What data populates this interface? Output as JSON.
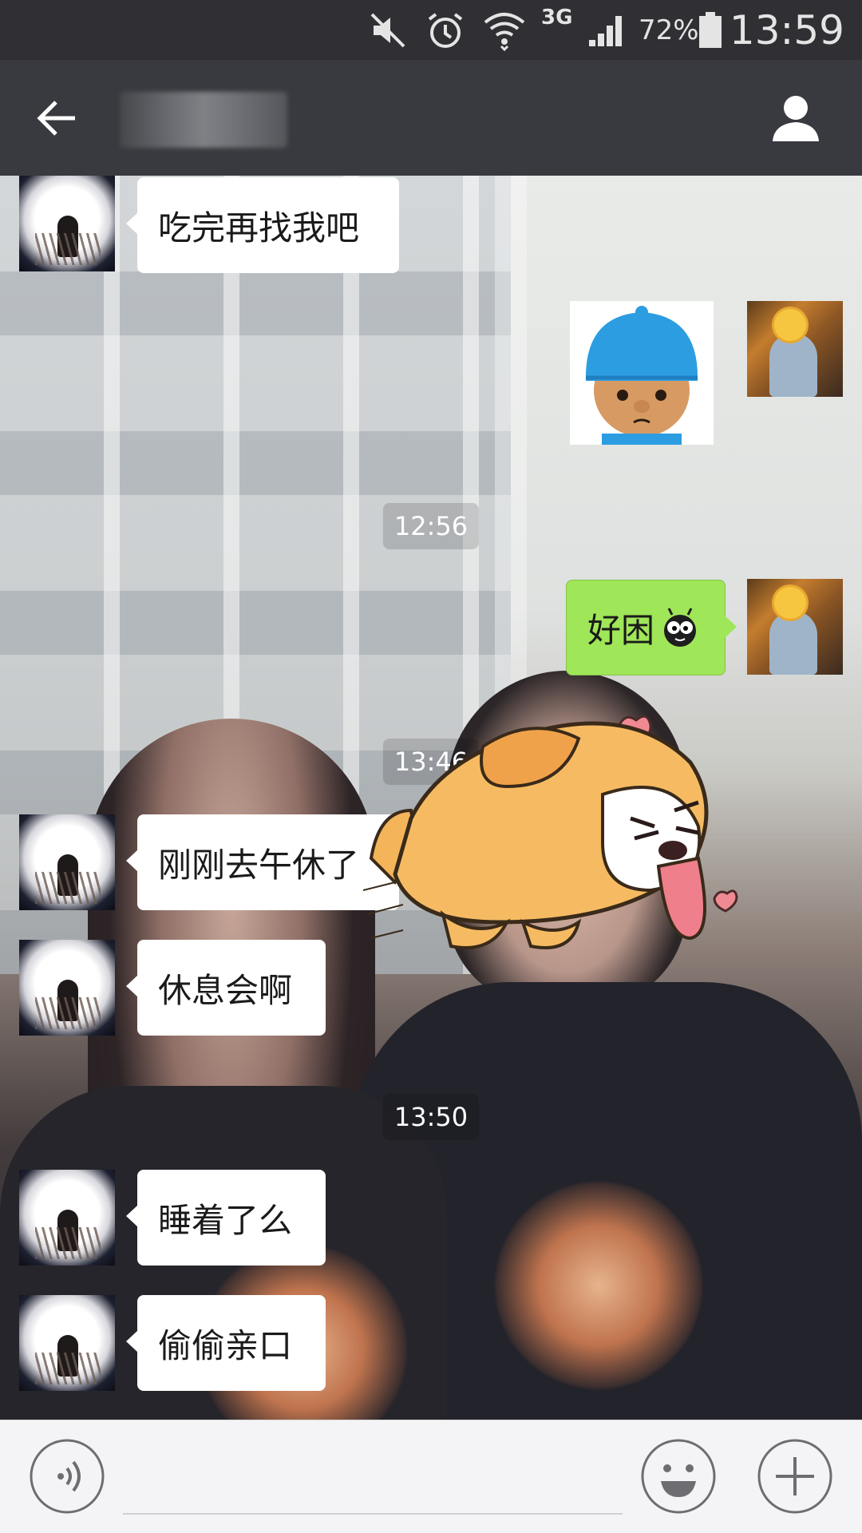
{
  "status_bar": {
    "icons": [
      "mute-icon",
      "alarm-icon",
      "wifi-icon",
      "network-3g-icon",
      "signal-icon",
      "battery-icon"
    ],
    "network_type": "3G",
    "battery_percent": "72%",
    "time": "13:59"
  },
  "header": {
    "back_icon": "arrow-left-icon",
    "contact_name": "",
    "profile_icon": "person-icon"
  },
  "messages": [
    {
      "type": "text",
      "direction": "incoming",
      "text": "吃完再找我吧"
    },
    {
      "type": "sticker",
      "direction": "outgoing",
      "sticker": "pocoyo-face"
    },
    {
      "type": "timestamp",
      "text": "12:56"
    },
    {
      "type": "text",
      "direction": "outgoing",
      "text": "好困",
      "emoji": "bug-eyes-emoji"
    },
    {
      "type": "timestamp",
      "text": "13:46"
    },
    {
      "type": "text",
      "direction": "incoming",
      "text": "刚刚去午休了"
    },
    {
      "type": "text",
      "direction": "incoming",
      "text": "休息会啊"
    },
    {
      "type": "timestamp",
      "text": "13:50"
    },
    {
      "type": "text",
      "direction": "incoming",
      "text": "睡着了么"
    },
    {
      "type": "text",
      "direction": "incoming",
      "text": "偷偷亲口"
    }
  ],
  "colors": {
    "status_bar_bg": "#303034",
    "top_bar_bg": "#393a3f",
    "incoming_bubble": "#ffffff",
    "outgoing_bubble": "#9fe658",
    "input_bar_bg": "#f4f4f6"
  },
  "input_bar": {
    "voice_icon": "voice-icon",
    "placeholder": "",
    "emoji_icon": "smiley-icon",
    "more_icon": "plus-icon"
  }
}
